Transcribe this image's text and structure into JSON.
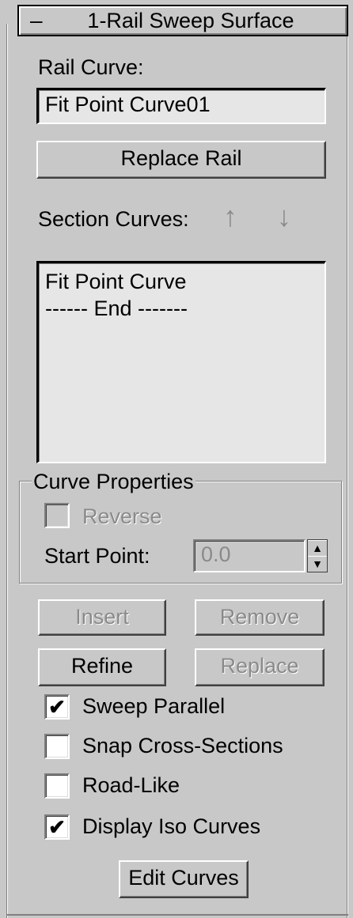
{
  "rollout": {
    "collapse_symbol": "–",
    "title": "1-Rail Sweep Surface"
  },
  "rail": {
    "label": "Rail Curve:",
    "value": "Fit Point Curve01",
    "replace_button": "Replace Rail"
  },
  "sections": {
    "label": "Section Curves:",
    "up_icon": "↑",
    "down_icon": "↓",
    "items": [
      "Fit Point Curve",
      "------ End -------"
    ]
  },
  "curve_properties": {
    "group_title": "Curve Properties",
    "reverse_label": "Reverse",
    "reverse_checked": false,
    "start_point_label": "Start Point:",
    "start_point_value": "0.0",
    "spinner_up": "▲",
    "spinner_down": "▼"
  },
  "buttons": {
    "insert": "Insert",
    "remove": "Remove",
    "refine": "Refine",
    "replace": "Replace",
    "edit_curves": "Edit Curves"
  },
  "options": [
    {
      "label": "Sweep Parallel",
      "checked": true,
      "mark": "✔"
    },
    {
      "label": "Snap Cross-Sections",
      "checked": false,
      "mark": ""
    },
    {
      "label": "Road-Like",
      "checked": false,
      "mark": ""
    },
    {
      "label": "Display Iso Curves",
      "checked": true,
      "mark": "✔"
    }
  ]
}
